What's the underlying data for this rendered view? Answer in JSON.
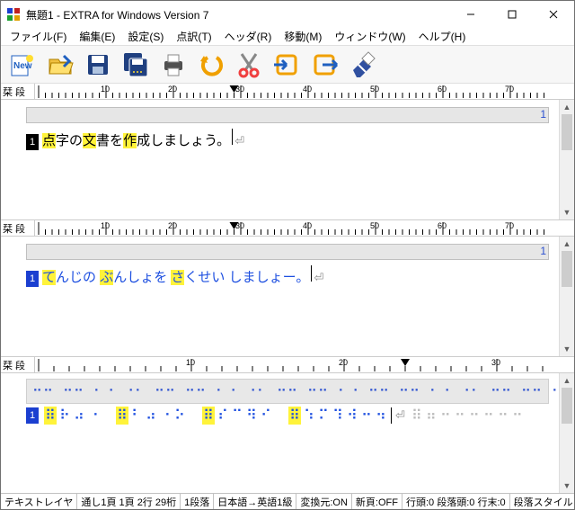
{
  "title": "無題1 - EXTRA for Windows Version 7",
  "menu": [
    "ファイル(F)",
    "編集(E)",
    "設定(S)",
    "点訳(T)",
    "ヘッダ(R)",
    "移動(M)",
    "ウィンドウ(W)",
    "ヘルプ(H)"
  ],
  "toolbar_icons": [
    "new",
    "open",
    "save",
    "save-all",
    "print",
    "undo",
    "cut",
    "import",
    "export",
    "eraser"
  ],
  "ruler_label": "栞 段",
  "pane1": {
    "header_num": "1",
    "line_num": "1",
    "segments": [
      {
        "t": "点",
        "hl": true
      },
      {
        "t": "字の",
        "hl": false
      },
      {
        "t": "文",
        "hl": true
      },
      {
        "t": "書を",
        "hl": false
      },
      {
        "t": "作",
        "hl": true
      },
      {
        "t": "成しましょう。",
        "hl": false
      }
    ]
  },
  "pane2": {
    "header_num": "1",
    "line_num": "1",
    "segments": [
      {
        "t": "て",
        "hl": true
      },
      {
        "t": "んじの ",
        "hl": false
      },
      {
        "t": "ぶ",
        "hl": true
      },
      {
        "t": "んしょを ",
        "hl": false
      },
      {
        "t": "さ",
        "hl": true
      },
      {
        "t": "くせい ",
        "hl": false
      },
      {
        "t": "し",
        "hl": false
      },
      {
        "t": "ましょー。",
        "hl": false
      }
    ]
  },
  "pane3": {
    "line_num": "1",
    "braille_top": "⠒⠒ ⠒⠒ ⠂⠐ ⠐⠂ ⠒⠒ ⠒⠒ ⠂⠐ ⠐⠂ ⠒⠒ ⠒⠒ ⠂⠐ ⠒⠒ ⠒⠒ ⠂⠐ ⠐⠂ ⠒⠒ ⠒⠒ ⠂⠐ ⠐⠂ ⠒⠒ ⠒⠒ ⠂⠐ ⠔⠢ ⠒⠒",
    "braille_cells": [
      {
        "g": "⠿",
        "hl": true
      },
      {
        "g": "⠗",
        "hl": false
      },
      {
        "g": "⠴",
        "hl": false
      },
      {
        "g": "⠐",
        "hl": false
      },
      {
        "g": " ",
        "hl": false
      },
      {
        "g": "⠿",
        "hl": true
      },
      {
        "g": "⠃",
        "hl": false
      },
      {
        "g": "⠴",
        "hl": false
      },
      {
        "g": "⠐",
        "hl": false
      },
      {
        "g": "⠕",
        "hl": false
      },
      {
        "g": " ",
        "hl": false
      },
      {
        "g": "⠿",
        "hl": true
      },
      {
        "g": "⠎",
        "hl": false
      },
      {
        "g": "⠉",
        "hl": false
      },
      {
        "g": "⠻",
        "hl": false
      },
      {
        "g": "⠊",
        "hl": false
      },
      {
        "g": " ",
        "hl": false
      },
      {
        "g": "⠿",
        "hl": true
      },
      {
        "g": "⠱",
        "hl": false
      },
      {
        "g": "⠍",
        "hl": false
      },
      {
        "g": "⠹",
        "hl": false
      },
      {
        "g": "⠺",
        "hl": false
      },
      {
        "g": "⠒",
        "hl": false
      },
      {
        "g": "⠲",
        "hl": false
      }
    ],
    "braille_tail": [
      "⠿",
      "⠶",
      "⠒",
      "⠒",
      "⠒",
      "⠒",
      "⠒",
      "⠒"
    ]
  },
  "status": [
    "テキストレイヤ",
    "通し1頁 1頁 2行 29桁",
    "1段落",
    "日本語→英語1級",
    "変換元:ON",
    "新頁:OFF",
    "行頭:0 段落頭:0 行末:0",
    "段落スタイル"
  ]
}
